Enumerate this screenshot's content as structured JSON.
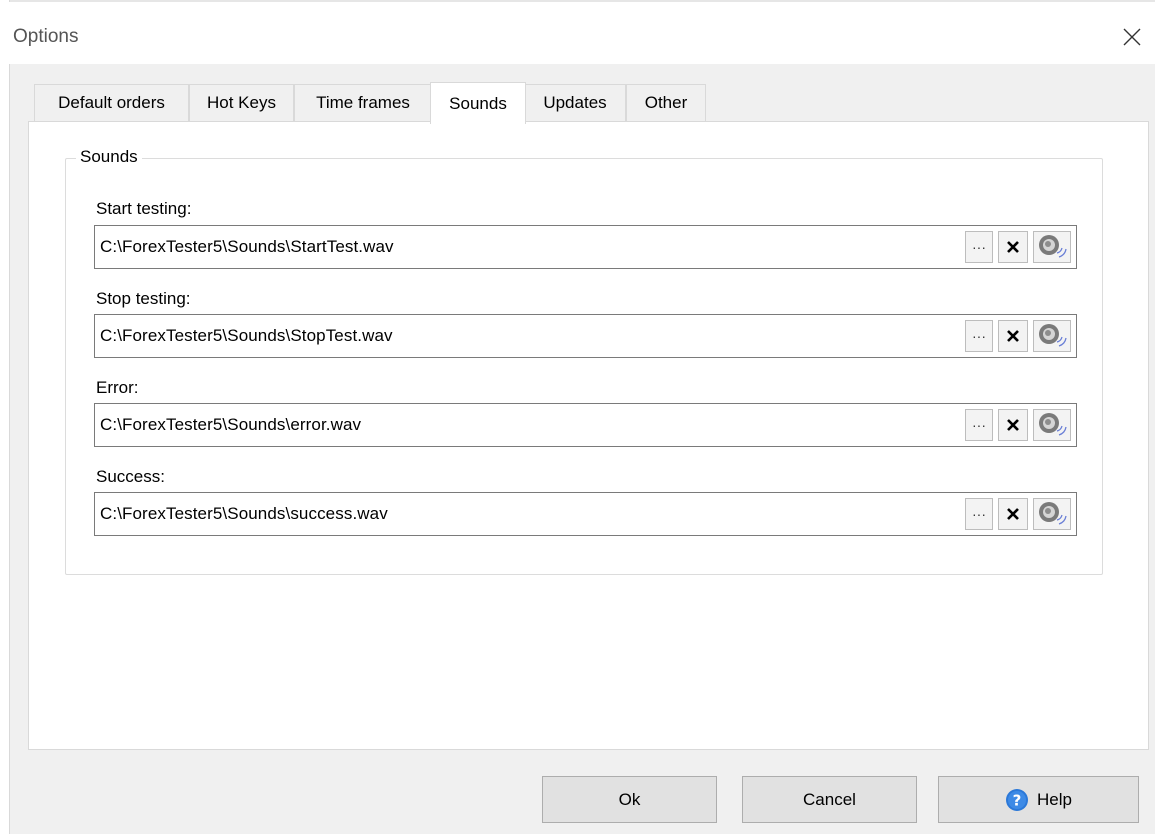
{
  "window": {
    "title": "Options"
  },
  "tabs": [
    {
      "label": "Default orders",
      "active": false
    },
    {
      "label": "Hot Keys",
      "active": false
    },
    {
      "label": "Time frames",
      "active": false
    },
    {
      "label": "Sounds",
      "active": true
    },
    {
      "label": "Updates",
      "active": false
    },
    {
      "label": "Other",
      "active": false
    }
  ],
  "sounds": {
    "group_title": "Sounds",
    "entries": [
      {
        "label": "Start testing:",
        "path": "C:\\ForexTester5\\Sounds\\StartTest.wav"
      },
      {
        "label": "Stop testing:",
        "path": "C:\\ForexTester5\\Sounds\\StopTest.wav"
      },
      {
        "label": "Error:",
        "path": "C:\\ForexTester5\\Sounds\\error.wav"
      },
      {
        "label": "Success:",
        "path": "C:\\ForexTester5\\Sounds\\success.wav"
      }
    ],
    "browse_label": "···"
  },
  "buttons": {
    "ok": "Ok",
    "cancel": "Cancel",
    "help": "Help"
  },
  "colors": {
    "help_icon": "#2b78d8",
    "speaker_icon": "#6f6f6f",
    "speaker_waves": "#6a7fd6"
  },
  "icons": {
    "close": "close-icon",
    "clear": "x-icon",
    "play": "speaker-icon",
    "help": "help-circle-icon"
  }
}
